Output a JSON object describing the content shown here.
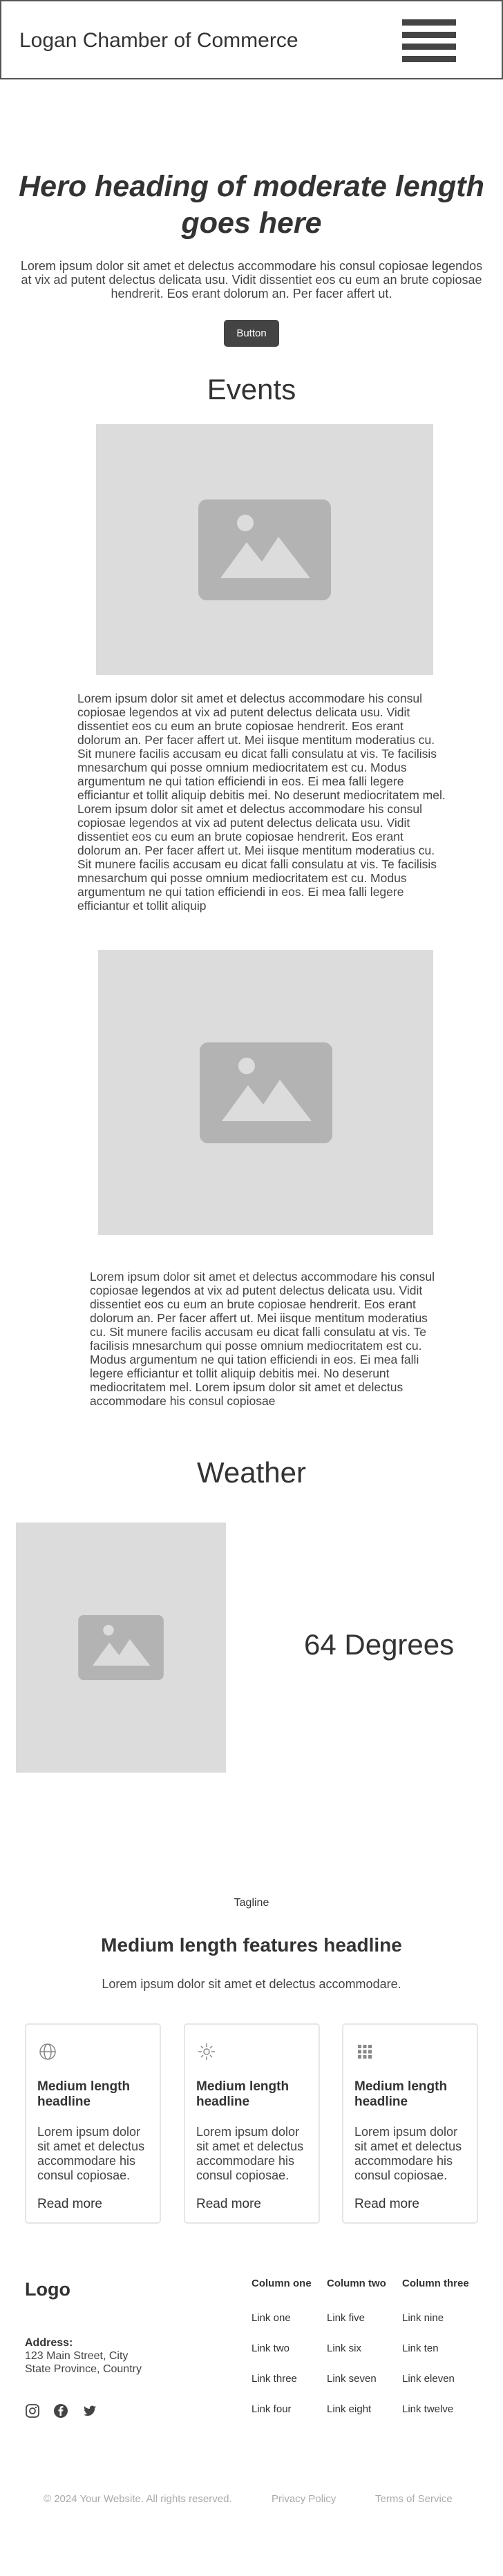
{
  "header": {
    "brand": "Logan Chamber of Commerce",
    "menu_icon": "hamburger-menu-icon"
  },
  "hero": {
    "heading": "Hero heading of moderate length goes here",
    "body": "Lorem ipsum dolor sit amet et delectus accommodare his consul copiosae legendos at vix ad putent delectus delicata usu. Vidit dissentiet eos cu eum an brute copiosae hendrerit. Eos erant dolorum an. Per facer affert ut.",
    "button": "Button"
  },
  "events": {
    "title": "Events",
    "items": [
      {
        "image_icon": "image-placeholder-icon",
        "text": "Lorem ipsum dolor sit amet et delectus accommodare his consul copiosae legendos at vix ad putent delectus delicata usu. Vidit dissentiet eos cu eum an brute copiosae hendrerit. Eos erant dolorum an. Per facer affert ut. Mei iisque mentitum moderatius cu. Sit munere facilis accusam eu dicat falli consulatu at vis. Te facilisis mnesarchum qui posse omnium mediocritatem est cu. Modus argumentum ne qui tation efficiendi in eos. Ei mea falli legere efficiantur et tollit aliquip debitis mei. No deserunt mediocritatem mel. Lorem ipsum dolor sit amet et delectus accommodare his consul copiosae legendos at vix ad putent delectus delicata usu. Vidit dissentiet eos cu eum an brute copiosae hendrerit. Eos erant dolorum an. Per facer affert ut. Mei iisque mentitum moderatius cu. Sit munere facilis accusam eu dicat falli consulatu at vis. Te facilisis mnesarchum qui posse omnium mediocritatem est cu. Modus argumentum ne qui tation efficiendi in eos. Ei mea falli legere efficiantur et tollit aliquip"
      },
      {
        "image_icon": "image-placeholder-icon",
        "text": "Lorem ipsum dolor sit amet et delectus accommodare his consul copiosae legendos at vix ad putent delectus delicata usu. Vidit dissentiet eos cu eum an brute copiosae hendrerit. Eos erant dolorum an. Per facer affert ut. Mei iisque mentitum moderatius cu. Sit munere facilis accusam eu dicat falli consulatu at vis. Te facilisis mnesarchum qui posse omnium mediocritatem est cu. Modus argumentum ne qui tation efficiendi in eos. Ei mea falli legere efficiantur et tollit aliquip debitis mei. No deserunt mediocritatem mel. Lorem ipsum dolor sit amet et delectus accommodare his consul copiosae"
      }
    ]
  },
  "weather": {
    "title": "Weather",
    "temperature": "64 Degrees",
    "image_icon": "image-placeholder-icon"
  },
  "features": {
    "tagline": "Tagline",
    "headline": "Medium length features headline",
    "subtext": "Lorem ipsum dolor sit amet et delectus accommodare.",
    "cards": [
      {
        "icon": "globe-icon",
        "title": "Medium length headline",
        "body": "Lorem ipsum dolor sit amet et delectus accommodare his consul copiosae.",
        "link": "Read more"
      },
      {
        "icon": "sparkle-icon",
        "title": "Medium length headline",
        "body": "Lorem ipsum dolor sit amet et delectus accommodare his consul copiosae.",
        "link": "Read more"
      },
      {
        "icon": "grid-icon",
        "title": "Medium length headline",
        "body": "Lorem ipsum dolor sit amet et delectus accommodare his consul copiosae.",
        "link": "Read more"
      }
    ]
  },
  "footer": {
    "logo": "Logo",
    "address_label": "Address:",
    "address_line1": "123 Main Street, City",
    "address_line2": "State Province, Country",
    "social_icons": [
      "instagram-icon",
      "facebook-icon",
      "twitter-icon"
    ],
    "columns": [
      {
        "heading": "Column one",
        "links": [
          "Link one",
          "Link two",
          "Link three",
          "Link four"
        ]
      },
      {
        "heading": "Column two",
        "links": [
          "Link five",
          "Link six",
          "Link seven",
          "Link eight"
        ]
      },
      {
        "heading": "Column three",
        "links": [
          "Link nine",
          "Link ten",
          "Link eleven",
          "Link twelve"
        ]
      }
    ],
    "copyright": "© 2024 Your Website. All rights reserved.",
    "privacy": "Privacy Policy",
    "terms": "Terms of Service"
  },
  "colors": {
    "placeholder_bg": "#dcdcdc",
    "placeholder_glyph": "#b3b3b3",
    "button_bg": "#444444",
    "text": "#333333"
  }
}
